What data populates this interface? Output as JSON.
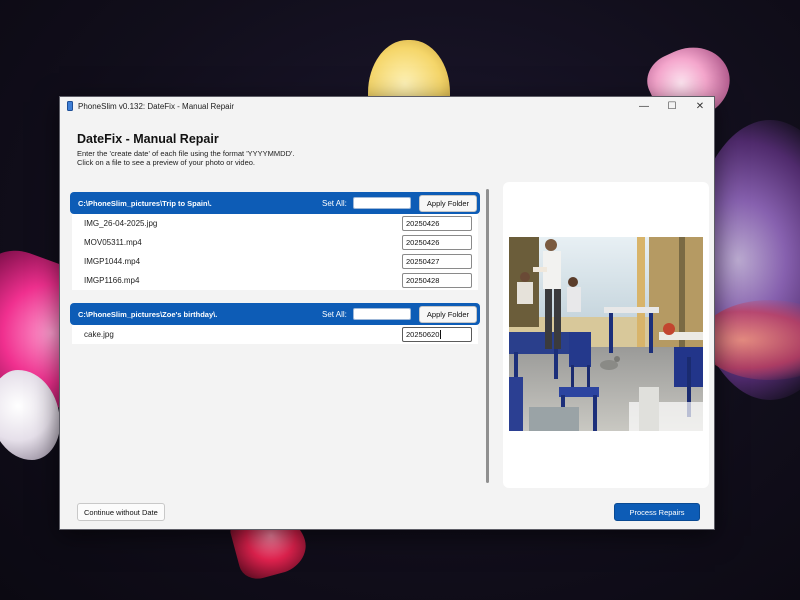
{
  "window": {
    "title": "PhoneSlim v0.132: DateFix - Manual Repair",
    "controls": {
      "minimize": "—",
      "maximize": "☐",
      "close": "✕"
    }
  },
  "page": {
    "heading": "DateFix - Manual Repair",
    "instructions": [
      "Enter the 'create date' of each file using the format 'YYYYMMDD'.",
      "Click on a file to see a preview of your photo or video."
    ]
  },
  "folders": [
    {
      "path": "C:\\PhoneSlim_pictures\\Trip to Spain\\.",
      "set_all_label": "Set All:",
      "set_all_value": "",
      "apply_label": "Apply Folder",
      "files": [
        {
          "name": "IMG_26-04-2025.jpg",
          "date": "20250426"
        },
        {
          "name": "MOV05311.mp4",
          "date": "20250426"
        },
        {
          "name": "IMGP1044.mp4",
          "date": "20250427"
        },
        {
          "name": "IMGP1166.mp4",
          "date": "20250428"
        }
      ]
    },
    {
      "path": "C:\\PhoneSlim_pictures\\Zoe's birthday\\.",
      "set_all_label": "Set All:",
      "set_all_value": "",
      "apply_label": "Apply Folder",
      "files": [
        {
          "name": "cake.jpg",
          "date": "20250620"
        }
      ]
    }
  ],
  "preview": {
    "description_icon": "photo-preview"
  },
  "footer": {
    "continue_label": "Continue without Date",
    "process_label": "Process Repairs"
  },
  "colors": {
    "accent": "#0d5cb6",
    "window_bg": "#f3f3f3"
  }
}
